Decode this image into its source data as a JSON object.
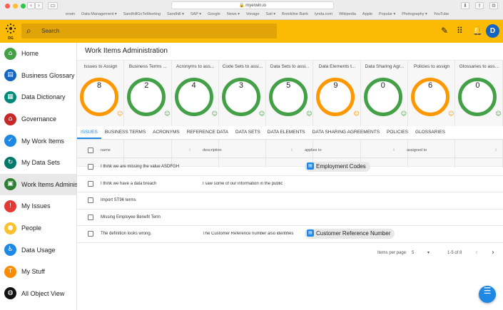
{
  "browser": {
    "url": "myerwin.io",
    "bookmarks": [
      "erwin",
      "Data Management ▾",
      "SandhillGoToMeeting",
      "Sandhill ▾",
      "SAP ▾",
      "Google",
      "News ▾",
      "Vonage",
      "Sail ▾",
      "Brookline Bank",
      "lynda.com",
      "Wikipedia",
      "Apple",
      "Popular ▾",
      "Photography ▾",
      "YouTube"
    ]
  },
  "header": {
    "search_placeholder": "Search",
    "avatar_letter": "D",
    "brand_color": "#fbbb05"
  },
  "sidebar": {
    "items": [
      {
        "label": "Home",
        "color": "#43a047",
        "icon": "home-icon",
        "glyph": "⌂"
      },
      {
        "label": "Business Glossary",
        "color": "#1565c0",
        "icon": "book-icon",
        "glyph": "▤"
      },
      {
        "label": "Data Dictionary",
        "color": "#00897b",
        "icon": "dictionary-icon",
        "glyph": "▦"
      },
      {
        "label": "Governance",
        "color": "#c62828",
        "icon": "bank-icon",
        "glyph": "⌂"
      },
      {
        "label": "My Work Items",
        "color": "#1e88e5",
        "icon": "checklist-icon",
        "glyph": "✓"
      },
      {
        "label": "My Data Sets",
        "color": "#00796b",
        "icon": "refresh-icon",
        "glyph": "↻"
      },
      {
        "label": "Work Items Administration",
        "color": "#2e7d32",
        "icon": "assignment-icon",
        "glyph": "▣"
      },
      {
        "label": "My Issues",
        "color": "#e53935",
        "icon": "issue-icon",
        "glyph": "!"
      },
      {
        "label": "People",
        "color": "#fbc02d",
        "icon": "person-icon",
        "glyph": "●"
      },
      {
        "label": "Data Usage",
        "color": "#1e88e5",
        "icon": "accessibility-icon",
        "glyph": "♿"
      },
      {
        "label": "My Stuff",
        "color": "#fb8c00",
        "icon": "stuff-icon",
        "glyph": "T"
      },
      {
        "label": "All Object View",
        "color": "#111111",
        "icon": "globe-icon",
        "glyph": "◍"
      }
    ]
  },
  "page": {
    "title": "Work Items Administration"
  },
  "cards": [
    {
      "title": "Issues to Assign",
      "count": "8",
      "status": "orange"
    },
    {
      "title": "Business Terms ...",
      "count": "2",
      "status": "green"
    },
    {
      "title": "Acronyms to ass...",
      "count": "4",
      "status": "green"
    },
    {
      "title": "Code Sets to assi...",
      "count": "3",
      "status": "green"
    },
    {
      "title": "Data Sets to assi...",
      "count": "5",
      "status": "green"
    },
    {
      "title": "Data Elements t...",
      "count": "9",
      "status": "orange"
    },
    {
      "title": "Data Sharing Agr...",
      "count": "0",
      "status": "green"
    },
    {
      "title": "Policies to assign",
      "count": "6",
      "status": "orange"
    },
    {
      "title": "Glossaries to ass...",
      "count": "0",
      "status": "green"
    }
  ],
  "tabs": [
    "ISSUES",
    "BUSINESS TERMS",
    "ACRONYMS",
    "REFERENCE DATA",
    "DATA SETS",
    "DATA ELEMENTS",
    "DATA SHARING AGREEMENTS",
    "POLICIES",
    "GLOSSARIES"
  ],
  "table": {
    "columns": [
      "name",
      "description",
      "applies to",
      "assigned to"
    ],
    "rows": [
      {
        "name": "I think we are missing the value ASDFGH",
        "description": "",
        "applies_to": "Employment Codes",
        "assigned_to": ""
      },
      {
        "name": "I think we have a data breach",
        "description": "I saw some of our information in the public",
        "applies_to": "",
        "assigned_to": ""
      },
      {
        "name": "Import ST96 terms",
        "description": "",
        "applies_to": "",
        "assigned_to": ""
      },
      {
        "name": "Missing Employee Benefit Term",
        "description": "",
        "applies_to": "",
        "assigned_to": ""
      },
      {
        "name": "The definition looks wrong.",
        "description": "The Customer Reference number also identifies",
        "applies_to": "Customer Reference Number",
        "assigned_to": ""
      }
    ]
  },
  "pager": {
    "label": "Items per page:",
    "per_page": "5",
    "range": "1-5 of 8"
  }
}
